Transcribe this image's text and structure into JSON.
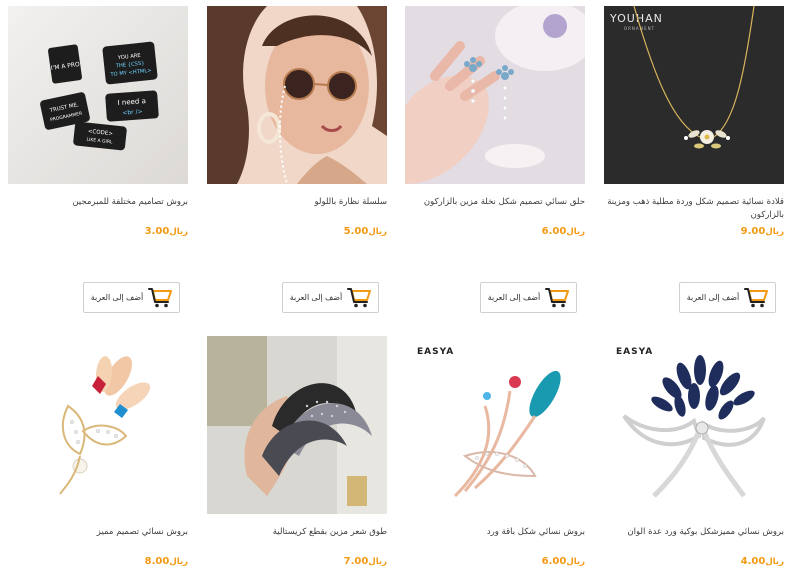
{
  "accent_color": "#f39a15",
  "currency": "ريال",
  "cart_icon": "shopping-cart-icon",
  "add_to_cart_label": "أضف إلى العربة",
  "row1": [
    {
      "title": "بروش تصاميم مختلفة للمبرمجين",
      "price": "3.00",
      "image": "programmer-pins",
      "pin_texts": [
        "I'M A PRO",
        "YOU ARE THE {CSS} TO MY <HTML>",
        "TRUST ME, I'M A PROGRAMMER",
        "I need a <br />",
        "<CODE> LIKE A GIRL"
      ]
    },
    {
      "title": "سلسلة نظارة باللولو",
      "price": "5.00",
      "image": "pearl-glasses-chain"
    },
    {
      "title": "حلق نسائي تصميم شكل نخلة مزين بالزاركون",
      "price": "6.00",
      "image": "palm-earrings"
    },
    {
      "title": "قلادة نسائية تصميم شكل وردة مطلية ذهب ومزينة بالزاركون",
      "price": "9.00",
      "image": "flower-necklace",
      "brand": "YOUHAN",
      "brand_sub": "ORNAMENT"
    }
  ],
  "row2": [
    {
      "title": "بروش نسائي تصميم مميز",
      "price": "8.00",
      "image": "leaf-brooch"
    },
    {
      "title": "طوق شعر مزين بقطع كريستالية",
      "price": "7.00",
      "image": "crystal-headband"
    },
    {
      "title": "بروش نسائي شكل باقة ورد",
      "price": "6.00",
      "image": "bouquet-brooch",
      "brand": "EASYA"
    },
    {
      "title": "بروش نسائي مميزشكل بوكية ورد عدة الوان",
      "price": "4.00",
      "image": "blue-bouquet-brooch",
      "brand": "EASYA"
    }
  ]
}
